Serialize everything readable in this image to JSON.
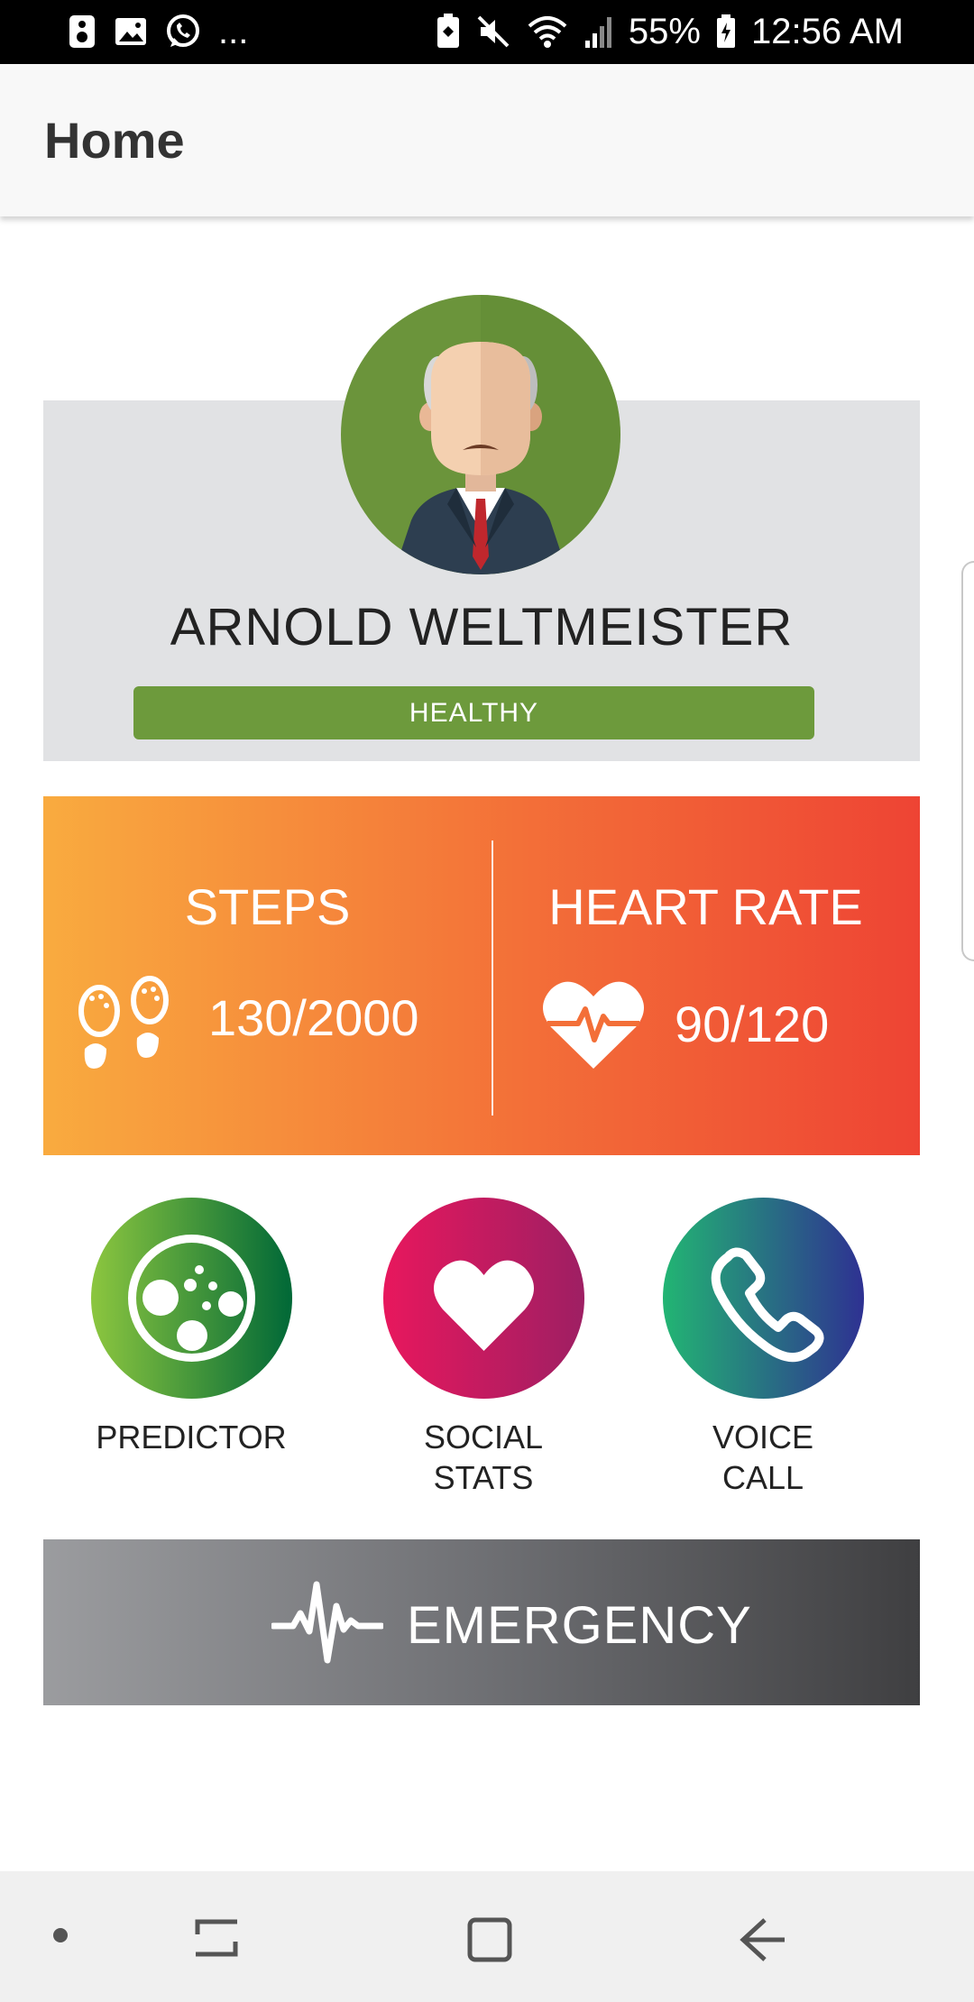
{
  "status_bar": {
    "notification_icons": [
      "voicemail-icon",
      "image-icon",
      "whatsapp-icon"
    ],
    "overflow": "...",
    "battery": "55%",
    "time": "12:56 AM"
  },
  "app_bar": {
    "title": "Home"
  },
  "profile": {
    "name": "ARNOLD WELTMEISTER",
    "status": "HEALTHY",
    "status_color": "#6d9a3c"
  },
  "stats": {
    "steps": {
      "title": "STEPS",
      "value": "130/2000"
    },
    "heart_rate": {
      "title": "HEART RATE",
      "value": "90/120"
    }
  },
  "actions": [
    {
      "label_line1": "PREDICTOR",
      "label_line2": ""
    },
    {
      "label_line1": "SOCIAL",
      "label_line2": "STATS"
    },
    {
      "label_line1": "VOICE",
      "label_line2": "CALL"
    }
  ],
  "emergency": {
    "label": "EMERGENCY"
  },
  "colors": {
    "stats_gradient_start": "#f9ab3f",
    "stats_gradient_end": "#ee4434",
    "predictor_gradient": [
      "#8cc63f",
      "#006837"
    ],
    "social_gradient": [
      "#e8175d",
      "#9e1f63"
    ],
    "voice_gradient": [
      "#22b573",
      "#2e3192"
    ]
  }
}
